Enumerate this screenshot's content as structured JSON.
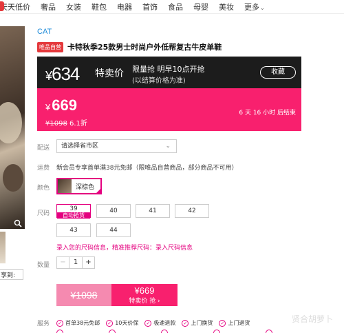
{
  "topnav": {
    "items": [
      "天天低价",
      "奢品",
      "女装",
      "鞋包",
      "电器",
      "首饰",
      "食品",
      "母婴",
      "美妆",
      "更多"
    ],
    "more_chevron": "⌄"
  },
  "product": {
    "brand": "CAT",
    "badge": "唯品自营",
    "title": "卡特秋季25款男士时尚户外低帮复古牛皮单鞋"
  },
  "price_panel": {
    "special_price": "634",
    "special_label": "特卖价",
    "flash_line1": "限量抢 明早10点开抢",
    "flash_line2": "(以结算价格为准)",
    "favorite_label": "收藏",
    "current_price": "669",
    "original_price": "¥1098",
    "discount": "6.1折",
    "countdown": "6 天 16 小时 后结束",
    "currency": "¥"
  },
  "delivery": {
    "label": "配送",
    "select_value": "请选择省市区"
  },
  "shipping": {
    "label": "运费",
    "text": "新会员专享首单满38元免邮（限唯品自营商品，部分商品不可用）"
  },
  "color": {
    "label": "颜色",
    "option": "深棕色"
  },
  "size": {
    "label": "尺码",
    "selected_size": "39",
    "auto_label": "自动抢货",
    "options": [
      "40",
      "41",
      "42",
      "43",
      "44"
    ],
    "tip_text": "录入您的尺码信息，精准推荐尺码：",
    "tip_link": "录入尺码信息"
  },
  "quantity": {
    "label": "数量",
    "value": "1",
    "minus": "−",
    "plus": "+"
  },
  "buy": {
    "original_price": "¥1098",
    "price": "¥669",
    "cta": "特卖价 抢 ›"
  },
  "services": {
    "label": "服务",
    "items": [
      "首单38元免邮",
      "10天价保",
      "极速退款",
      "上门换货",
      "上门退货"
    ]
  },
  "left": {
    "share_label": "享到:"
  },
  "watermark": "贤合胡萝卜",
  "colors": {
    "accent_pink": "#f8206e",
    "magenta": "#e4007f",
    "brand_blue": "#1d8bd9",
    "dark_bar": "#1c1c1c"
  }
}
